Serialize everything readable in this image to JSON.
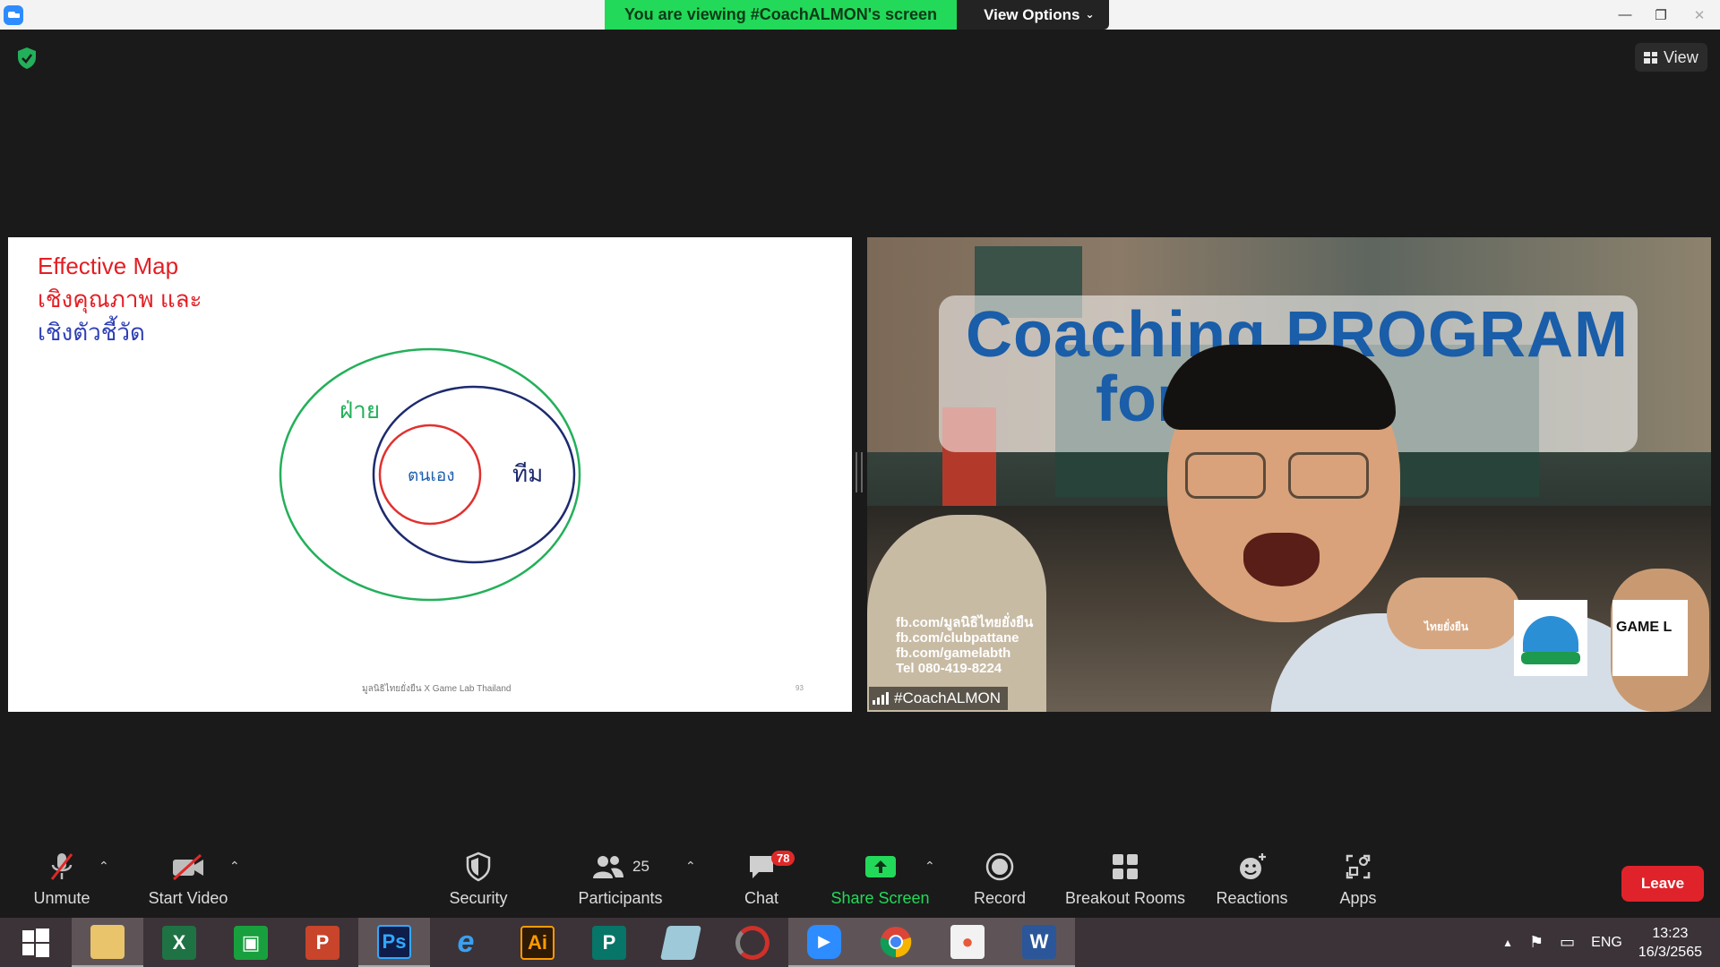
{
  "titlebar": {
    "viewing_text": "You are viewing #CoachALMON's screen",
    "view_options_label": "View Options",
    "icons": [
      "zoom-logo-icon",
      "chevron-down-icon",
      "minimize-icon",
      "restore-icon",
      "close-icon"
    ]
  },
  "meeting": {
    "view_label": "View",
    "shared_slide": {
      "title_line1": "Effective Map",
      "title_line2": "เชิงคุณภาพ และ",
      "title_line3": "เชิงตัวชี้วัด",
      "outer_label": "ฝ่าย",
      "middle_label": "ทีม",
      "inner_label": "ตนเอง",
      "footer": "มูลนิธิไทยยั่งยืน X Game Lab Thailand",
      "page_number": "93",
      "colors": {
        "outer_circle": "#23b05a",
        "middle_circle": "#1d2a6e",
        "inner_circle": "#e0312f",
        "inner_label": "#1d5fb0"
      }
    },
    "video": {
      "banner_line1": "Coaching PROGRAM",
      "banner_line2": "for    urer",
      "contact_lines": [
        "fb.com/มูลนิธิไทยยั่งยืน",
        "fb.com/clubpattane",
        "fb.com/gamelabth",
        "Tel 080-419-8224"
      ],
      "side_text": "ไทยยั่งยืน",
      "logo2_text": "GAME L",
      "participant_name": "#CoachALMON"
    }
  },
  "toolbar": {
    "unmute": "Unmute",
    "start_video": "Start Video",
    "security": "Security",
    "participants": "Participants",
    "participants_count": "25",
    "chat": "Chat",
    "chat_badge": "78",
    "share_screen": "Share Screen",
    "record": "Record",
    "breakout_rooms": "Breakout Rooms",
    "reactions": "Reactions",
    "apps": "Apps",
    "leave": "Leave",
    "accent_green": "#23d959",
    "leave_color": "#e0232a"
  },
  "taskbar": {
    "apps": [
      "windows-start",
      "file-explorer",
      "excel",
      "store",
      "powerpoint",
      "photoshop",
      "internet-explorer",
      "illustrator",
      "publisher",
      "notepad",
      "photoscape",
      "zoom",
      "chrome",
      "presenter",
      "word"
    ],
    "labels": {
      "excel": "X",
      "powerpoint": "P",
      "photoshop": "Ps",
      "illustrator": "Ai",
      "publisher": "P",
      "word": "W"
    },
    "tray": {
      "language": "ENG",
      "time": "13:23",
      "date": "16/3/2565"
    }
  }
}
